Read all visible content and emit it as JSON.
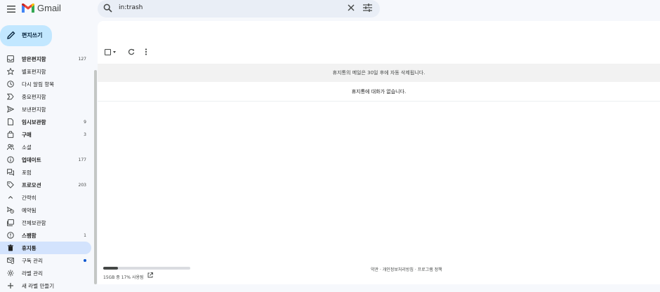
{
  "app": {
    "name": "Gmail"
  },
  "search": {
    "query": "in:trash"
  },
  "compose": {
    "label": "편지쓰기"
  },
  "nav": [
    {
      "label": "받은편지함",
      "count": "127",
      "bold": true,
      "icon": "inbox-icon"
    },
    {
      "label": "별표편지함",
      "count": "",
      "bold": false,
      "icon": "star-icon"
    },
    {
      "label": "다시 알림 항목",
      "count": "",
      "bold": false,
      "icon": "clock-icon"
    },
    {
      "label": "중요편지함",
      "count": "",
      "bold": false,
      "icon": "important-icon"
    },
    {
      "label": "보낸편지함",
      "count": "",
      "bold": false,
      "icon": "send-icon"
    },
    {
      "label": "임시보관함",
      "count": "9",
      "bold": true,
      "icon": "draft-icon"
    },
    {
      "label": "구매",
      "count": "3",
      "bold": true,
      "icon": "purchase-icon"
    },
    {
      "label": "소셜",
      "count": "",
      "bold": false,
      "icon": "people-icon"
    },
    {
      "label": "업데이트",
      "count": "177",
      "bold": true,
      "icon": "info-icon"
    },
    {
      "label": "포럼",
      "count": "",
      "bold": false,
      "icon": "forum-icon"
    },
    {
      "label": "프로모션",
      "count": "203",
      "bold": true,
      "icon": "tag-icon"
    },
    {
      "label": "간략히",
      "count": "",
      "bold": false,
      "icon": "chevron-up-icon"
    },
    {
      "label": "예약됨",
      "count": "",
      "bold": false,
      "icon": "scheduled-icon"
    },
    {
      "label": "전체보관함",
      "count": "",
      "bold": false,
      "icon": "all-mail-icon"
    },
    {
      "label": "스팸함",
      "count": "1",
      "bold": true,
      "icon": "spam-icon"
    },
    {
      "label": "휴지통",
      "count": "",
      "bold": true,
      "icon": "trash-icon",
      "active": true
    },
    {
      "label": "구독 관리",
      "count": "",
      "bold": false,
      "icon": "subscriptions-icon",
      "dot": true
    },
    {
      "label": "라벨 관리",
      "count": "",
      "bold": false,
      "icon": "settings-icon"
    },
    {
      "label": "새 라벨 만들기",
      "count": "",
      "bold": false,
      "icon": "plus-icon"
    }
  ],
  "main": {
    "banner": "휴지통의 메일은 30일 후에 자동 삭제됩니다.",
    "empty_message": "휴지통에 대화가 없습니다."
  },
  "storage": {
    "text": "15GB 중 17% 사용됨",
    "used_fraction": 0.17
  },
  "footer": {
    "text": "약관 · 개인정보처리방침 · 프로그램 정책"
  },
  "colors": {
    "accent": "#0b57d0",
    "compose_bg": "#c2e7ff",
    "active_nav_bg": "#d3e3fd",
    "search_bg": "#e9eef6"
  }
}
